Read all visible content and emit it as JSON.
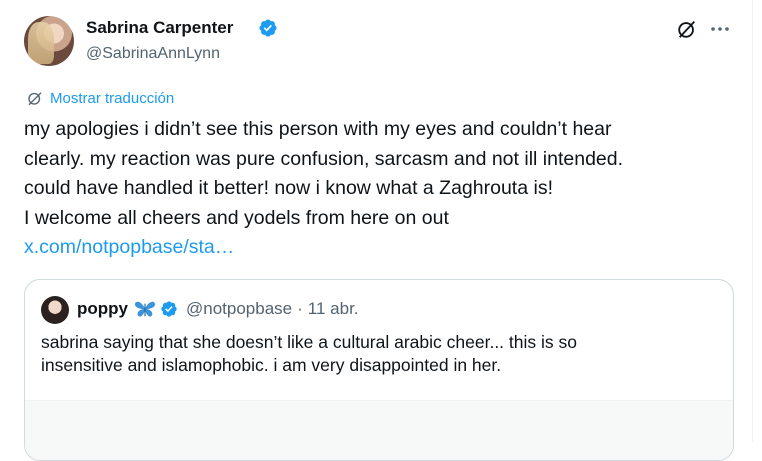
{
  "author": {
    "name": "Sabrina Carpenter",
    "handle": "@SabrinaAnnLynn",
    "verified": true
  },
  "header_actions": {
    "grok_icon": "grok-icon",
    "more_icon": "more-icon"
  },
  "translate_label": "Mostrar traducción",
  "tweet": {
    "lines": [
      "my apologies i didn’t see this person with my eyes and couldn’t hear",
      "clearly. my reaction was pure confusion, sarcasm and not ill intended.",
      "could have handled it better! now i know what a Zaghrouta is!",
      "I welcome all cheers and yodels from here on out"
    ],
    "link": "x.com/notpopbase/sta…"
  },
  "quote": {
    "name": "poppy",
    "emoji": "butterfly-icon",
    "verified": true,
    "handle": "@notpopbase",
    "separator": "·",
    "date": "11 abr.",
    "lines": [
      "sabrina saying that she doesn’t like a cultural arabic cheer... this is so",
      "insensitive and islamophobic. i am very disappointed in her."
    ]
  },
  "colors": {
    "text": "#0f1419",
    "secondary": "#536471",
    "accent": "#1d9bf0",
    "border": "#cfd9de"
  }
}
